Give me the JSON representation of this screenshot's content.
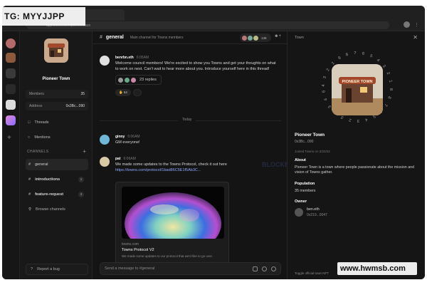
{
  "watermarks": {
    "top_left": "TG: MYYJJPP",
    "bottom_right": "www.hwmsb.com",
    "center": "BLOCKBEATS"
  },
  "browser": {
    "url": "app.towns.com/pioneertown"
  },
  "sidebar": {
    "town_name": "Pioneer Town",
    "members_label": "Members",
    "members_value": "35",
    "address_label": "Address",
    "address_value": "0x3Bc...090",
    "nav": [
      {
        "label": "Threads"
      },
      {
        "label": "Mentions"
      }
    ],
    "channels_header": "CHANNELS",
    "channels": [
      {
        "label": "general",
        "badge": ""
      },
      {
        "label": "introductions",
        "badge": "1"
      },
      {
        "label": "feature-request",
        "badge": "3"
      },
      {
        "label": "Browse channels",
        "badge": ""
      }
    ],
    "report_label": "Report a bug"
  },
  "channel": {
    "title": "general",
    "topic": "Main channel for Towns members",
    "member_count": "138"
  },
  "messages": [
    {
      "name": "benrbn.eth",
      "time": "6:05AM",
      "text": "Welcome council members! We're excited to show you Towns and get your thoughts on what to work on next. Can't wait to hear more about you. Introduce yourself here in this thread!",
      "replies": "23 replies",
      "reaction_count": "64"
    },
    {
      "name": "ginny",
      "time": "6:06AM",
      "text": "GM everyone!"
    },
    {
      "name": "pat",
      "time": "6:06AM",
      "text": "We made some updates to the Towns Protocol, check it out here",
      "link": "https://towns.com/protocol/1bad86C5E1f5Ab3C..."
    }
  ],
  "divider": "Today",
  "preview": {
    "domain": "towns.com",
    "title": "Towns Protocol V2",
    "desc": "We made some updates to our protocol that we'd like to go over"
  },
  "composer": {
    "placeholder": "Send a message to #general"
  },
  "panel": {
    "header": "Town",
    "title": "Pioneer Town",
    "address": "0x3Bc...090",
    "joined": "Joined Towns on 2/22/22",
    "about_label": "About",
    "about_text": "Pioneer Town is a town where people passionate about the mission and vision of Towns gather.",
    "population_label": "Population",
    "population_text": "35 members",
    "owner_label": "Owner",
    "owner_name": "ben.eth",
    "owner_addr": "0x219...0047",
    "footer": "Toggle official town NFT",
    "art_text": "PIONEER TOWN",
    "ring_text": "4 3 2 1 9 8 7 6 5 4 3 2 1 0 8 7 6 5 4 3 2 3 0 3 4 6 3"
  },
  "colors": {
    "background": "#141414",
    "accent_link": "#8ea7ff"
  }
}
